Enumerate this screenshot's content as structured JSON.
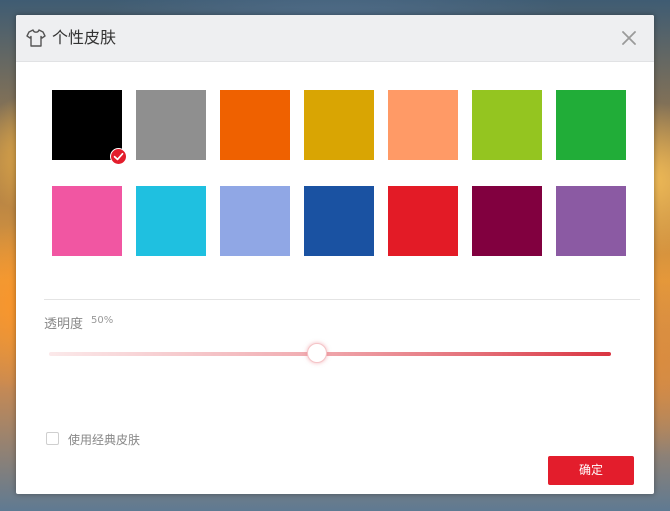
{
  "dialog": {
    "title": "个性皮肤",
    "title_icon": "tshirt-icon",
    "close_icon": "close-icon"
  },
  "colors": {
    "accent": "#e31d2c",
    "swatches": [
      {
        "name": "black",
        "hex": "#000000",
        "selected": true
      },
      {
        "name": "gray",
        "hex": "#8f8f8f",
        "selected": false
      },
      {
        "name": "orange",
        "hex": "#ef6100",
        "selected": false
      },
      {
        "name": "gold",
        "hex": "#d9a503",
        "selected": false
      },
      {
        "name": "peach",
        "hex": "#ff9a66",
        "selected": false
      },
      {
        "name": "lime",
        "hex": "#94c520",
        "selected": false
      },
      {
        "name": "green",
        "hex": "#21ad38",
        "selected": false
      },
      {
        "name": "pink",
        "hex": "#f156a2",
        "selected": false
      },
      {
        "name": "cyan",
        "hex": "#1fc0e0",
        "selected": false
      },
      {
        "name": "lavender",
        "hex": "#90a7e5",
        "selected": false
      },
      {
        "name": "blue",
        "hex": "#1a52a2",
        "selected": false
      },
      {
        "name": "red",
        "hex": "#e31b26",
        "selected": false
      },
      {
        "name": "wine",
        "hex": "#81003f",
        "selected": false
      },
      {
        "name": "purple",
        "hex": "#8b5aa3",
        "selected": false
      }
    ]
  },
  "opacity": {
    "label": "透明度",
    "value_text": "50%",
    "value": 0.5
  },
  "classic_skin": {
    "label": "使用经典皮肤",
    "checked": false
  },
  "confirm_label": "确定"
}
